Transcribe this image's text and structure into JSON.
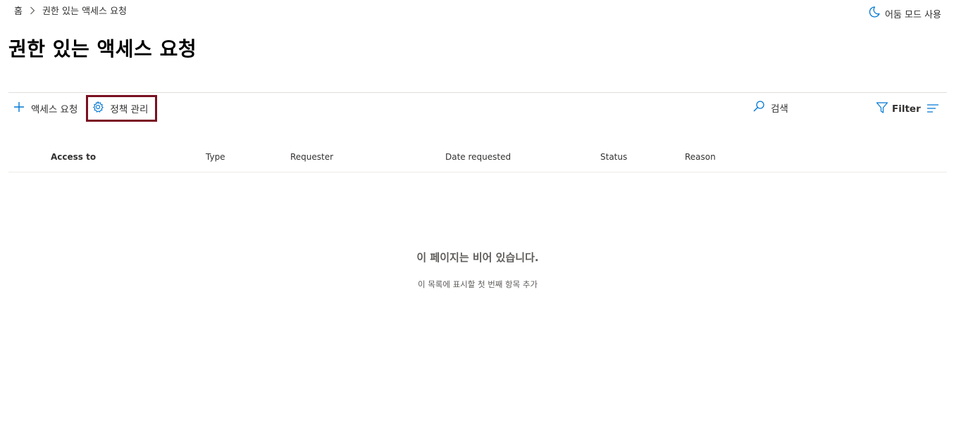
{
  "breadcrumb": {
    "home": "홈",
    "current": "권한 있는 액세스 요청"
  },
  "header": {
    "dark_mode_label": "어둠 모드 사용",
    "title": "권한 있는 액세스 요청"
  },
  "toolbar": {
    "request_access_label": "액세스 요청",
    "manage_policy_label": "정책 관리",
    "search_label": "검색",
    "filter_label": "Filter",
    "icons": {
      "add": "plus-icon",
      "policy": "gear-icon",
      "search": "search-icon",
      "filter": "filter-icon",
      "menu": "lines-icon",
      "dark_mode": "moon-icon"
    }
  },
  "table": {
    "columns": [
      "Access to",
      "Type",
      "Requester",
      "Date requested",
      "Status",
      "Reason"
    ]
  },
  "empty_state": {
    "title": "이 페이지는 비어 있습니다.",
    "subtitle": "이 목록에 표시할 첫 번째 항목 추가"
  },
  "colors": {
    "accent": "#0078d4",
    "highlight_border": "#7a1022",
    "text": "#323130"
  }
}
